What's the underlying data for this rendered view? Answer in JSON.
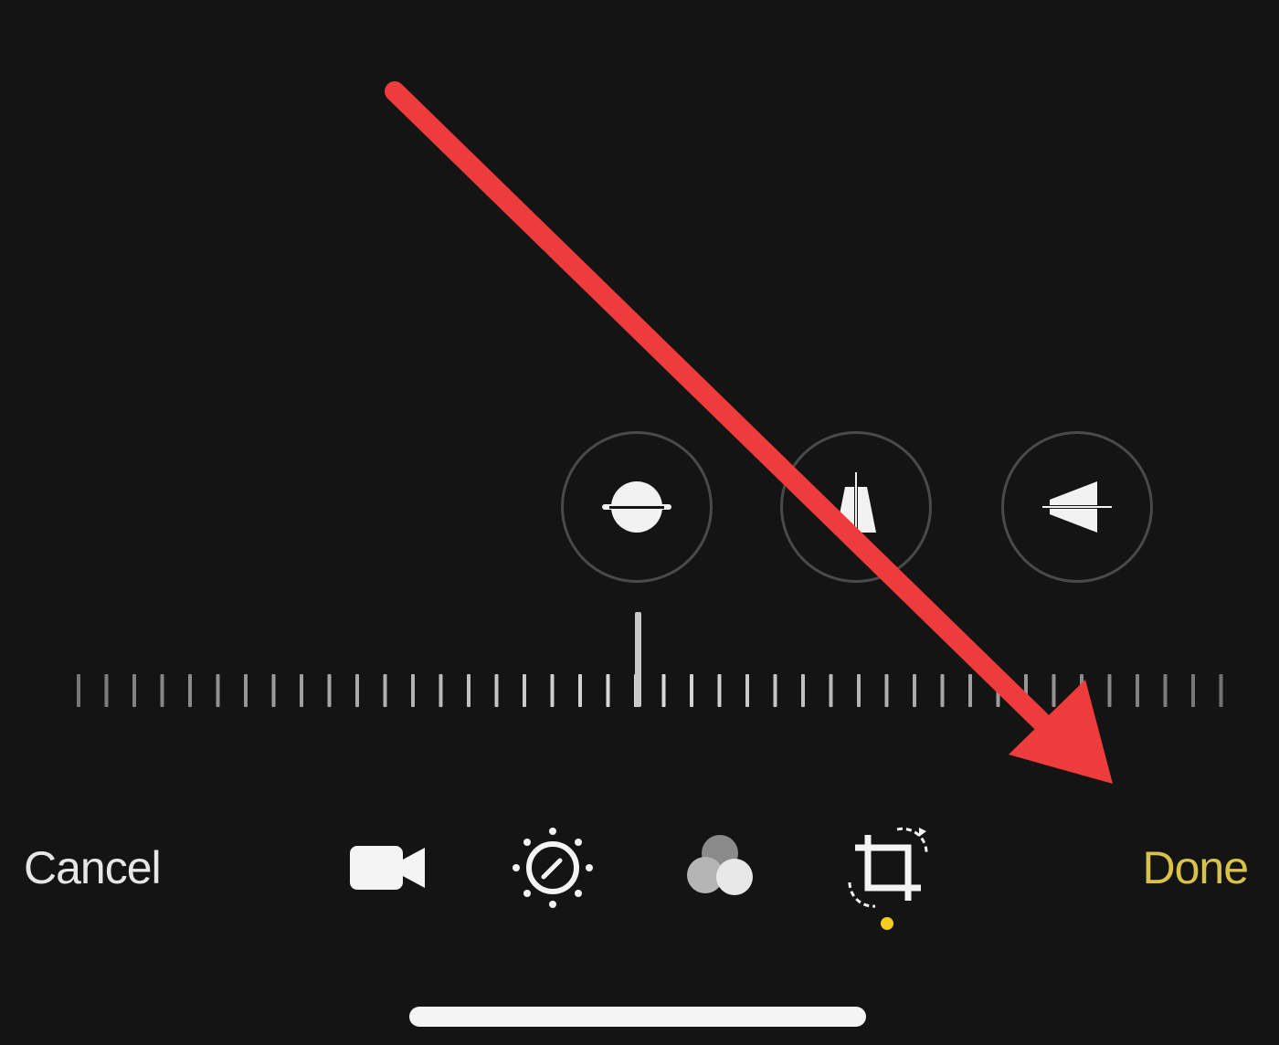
{
  "toolbar": {
    "cancel_label": "Cancel",
    "done_label": "Done",
    "tools": [
      {
        "icon": "video-camera-icon",
        "name": "video"
      },
      {
        "icon": "adjust-dial-icon",
        "name": "adjust"
      },
      {
        "icon": "filters-icon",
        "name": "filters"
      },
      {
        "icon": "crop-rotate-icon",
        "name": "crop",
        "active": true
      }
    ]
  },
  "adjust_buttons": [
    {
      "icon": "straighten-icon",
      "name": "straighten"
    },
    {
      "icon": "vertical-perspective-icon",
      "name": "vertical"
    },
    {
      "icon": "horizontal-perspective-icon",
      "name": "horizontal"
    }
  ],
  "ruler": {
    "value": 0
  },
  "colors": {
    "background": "#141414",
    "done": "#d8c24a",
    "active_dot": "#f2cc1f",
    "annotation_arrow": "#ee3b3b"
  }
}
